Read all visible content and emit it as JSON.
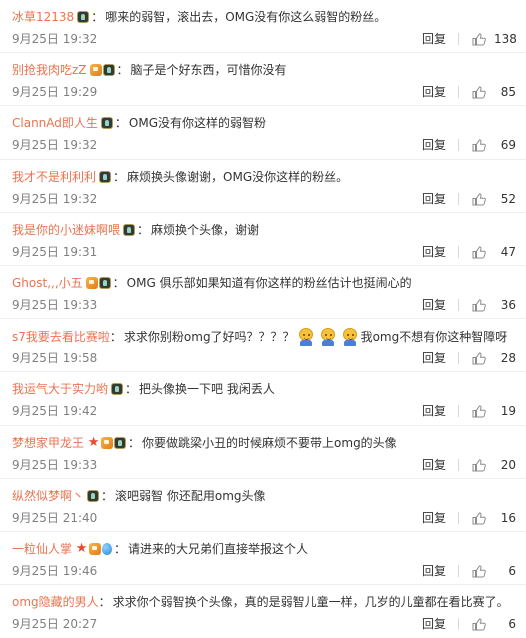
{
  "comments": [
    {
      "username": "冰草12138",
      "badges": [
        "lol"
      ],
      "text": "哪来的弱智，滚出去，OMG没有你这么弱智的粉丝。",
      "time": "9月25日 19:32",
      "reply": "回复",
      "likes": "138"
    },
    {
      "username": "别抢我肉吃zZ",
      "badges": [
        "verify",
        "lol"
      ],
      "text": "脑子是个好东西，可惜你没有",
      "time": "9月25日 19:29",
      "reply": "回复",
      "likes": "85"
    },
    {
      "username": "ClannAd即人生",
      "badges": [
        "lol"
      ],
      "text": "OMG没有你这样的弱智粉",
      "time": "9月25日 19:32",
      "reply": "回复",
      "likes": "69"
    },
    {
      "username": "我才不是利利利",
      "badges": [
        "lol"
      ],
      "text": "麻烦换头像谢谢，OMG没你这样的粉丝。",
      "time": "9月25日 19:32",
      "reply": "回复",
      "likes": "52"
    },
    {
      "username": "我是你的小迷妹啊喂",
      "badges": [
        "lol"
      ],
      "text": "麻烦换个头像，谢谢",
      "time": "9月25日 19:31",
      "reply": "回复",
      "likes": "47"
    },
    {
      "username": "Ghost,,,小五",
      "badges": [
        "verify",
        "lol"
      ],
      "text": "OMG 俱乐部如果知道有你这样的粉丝估计也挺闹心的",
      "time": "9月25日 19:33",
      "reply": "回复",
      "likes": "36"
    },
    {
      "username": "s7我要去看比赛啦",
      "badges": [],
      "text": "求求你别粉omg了好吗？？？？",
      "text_after": "我omg不想有你这种智障呀",
      "emoji_count": 3,
      "emoji": "crying-face-icon",
      "time": "9月25日 19:58",
      "reply": "回复",
      "likes": "28"
    },
    {
      "username": "我运气大于实力哟",
      "badges": [
        "lol"
      ],
      "text": "把头像换一下吧  我闲丢人",
      "time": "9月25日 19:42",
      "reply": "回复",
      "likes": "19"
    },
    {
      "username": "梦想家甲龙王",
      "badges": [
        "star",
        "verify",
        "lol"
      ],
      "text": "你要做跳梁小丑的时候麻烦不要带上omg的头像",
      "time": "9月25日 19:33",
      "reply": "回复",
      "likes": "20"
    },
    {
      "username": "纵然似梦啊丶",
      "badges": [
        "lol"
      ],
      "text": "滚吧弱智 你还配用omg头像",
      "time": "9月25日 21:40",
      "reply": "回复",
      "likes": "16"
    },
    {
      "username": "一粒仙人掌",
      "badges": [
        "star",
        "verify",
        "balloon"
      ],
      "text": "请进来的大兄弟们直接举报这个人",
      "time": "9月25日 19:46",
      "reply": "回复",
      "likes": "6"
    },
    {
      "username": "omg隐藏的男人",
      "badges": [],
      "text": "求求你个弱智换个头像，真的是弱智儿童一样，几岁的儿童都在看比赛了。",
      "time": "9月25日 20:27",
      "reply": "回复",
      "likes": "6"
    }
  ],
  "colors": {
    "username": "#eb7350",
    "time": "#808080",
    "text": "#333333"
  }
}
